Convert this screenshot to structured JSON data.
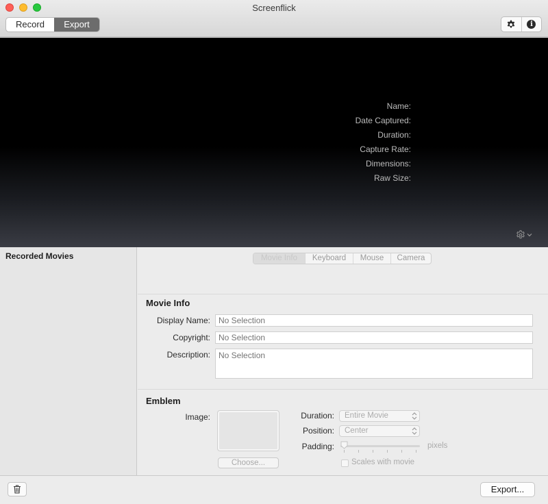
{
  "window": {
    "title": "Screenflick"
  },
  "toolbar": {
    "modes": [
      {
        "label": "Record",
        "selected": false
      },
      {
        "label": "Export",
        "selected": true
      }
    ],
    "buttons": [
      {
        "icon": "gear-icon"
      },
      {
        "icon": "info-icon",
        "glyph": "i"
      }
    ]
  },
  "preview": {
    "metadata_labels": [
      "Name:",
      "Date Captured:",
      "Duration:",
      "Capture Rate:",
      "Dimensions:",
      "Raw Size:"
    ],
    "action_icon": "gear-dropdown-icon"
  },
  "sidebar": {
    "title": "Recorded Movies"
  },
  "inspector": {
    "tabs": [
      {
        "label": "Movie Info",
        "active": true
      },
      {
        "label": "Keyboard",
        "active": false
      },
      {
        "label": "Mouse",
        "active": false
      },
      {
        "label": "Camera",
        "active": false
      }
    ],
    "movie_info": {
      "title": "Movie Info",
      "display_name": {
        "label": "Display Name:",
        "placeholder": "No Selection"
      },
      "copyright": {
        "label": "Copyright:",
        "placeholder": "No Selection"
      },
      "description": {
        "label": "Description:",
        "placeholder": "No Selection"
      }
    },
    "emblem": {
      "title": "Emblem",
      "image_label": "Image:",
      "choose_label": "Choose...",
      "duration": {
        "label": "Duration:",
        "value": "Entire Movie"
      },
      "position": {
        "label": "Position:",
        "value": "Center"
      },
      "padding": {
        "label": "Padding:",
        "units": "pixels",
        "level": 0
      },
      "scales": {
        "label": "Scales with movie",
        "checked": false
      }
    }
  },
  "bottom": {
    "export_label": "Export..."
  },
  "colors": {
    "toolbar_selected": "#6c6c6c",
    "preview_bg": "#000000",
    "metadata_text": "#bcbcbc"
  }
}
